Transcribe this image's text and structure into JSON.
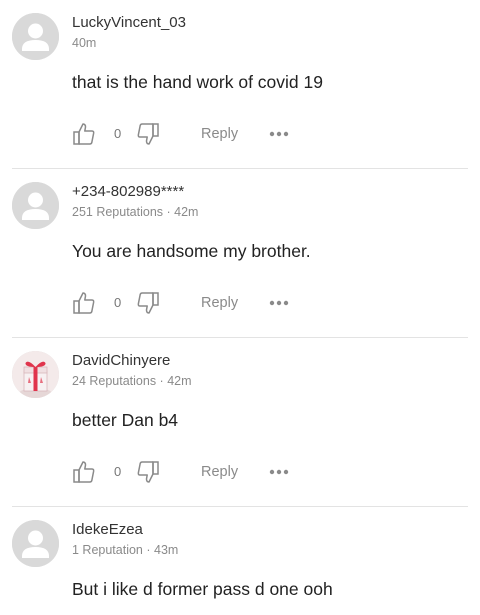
{
  "comments": [
    {
      "author": "LuckyVincent_03",
      "meta": "40m",
      "text": "that is the hand work of covid 19",
      "likes": "0",
      "reply_label": "Reply",
      "avatar": "default-avatar"
    },
    {
      "author": "+234-802989****",
      "meta": "251 Reputations · 42m",
      "text": "You are handsome my brother.",
      "likes": "0",
      "reply_label": "Reply",
      "avatar": "default-avatar"
    },
    {
      "author": "DavidChinyere",
      "meta": "24 Reputations · 42m",
      "text": "better Dan b4",
      "likes": "0",
      "reply_label": "Reply",
      "avatar": "gift-avatar"
    },
    {
      "author": "IdekeEzea",
      "meta": "1 Reputation · 43m",
      "text": "But i like d former pass d one ooh",
      "avatar": "default-avatar"
    }
  ],
  "colors": {
    "icon_stroke": "#8a8a8a",
    "divider": "#e3e3e3",
    "avatar_bg": "#d9d9d9"
  }
}
